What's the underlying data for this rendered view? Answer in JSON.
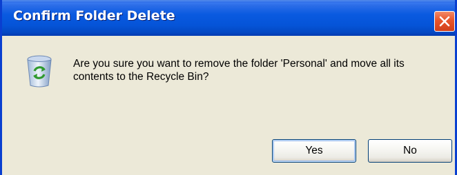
{
  "dialog": {
    "title": "Confirm Folder Delete",
    "message": "Are you sure you want to remove the folder 'Personal' and move all its contents to the Recycle Bin?",
    "icon": "recycle-bin-icon",
    "close_icon": "close-icon",
    "buttons": {
      "yes_label": "Yes",
      "no_label": "No"
    }
  },
  "colors": {
    "titlebar": "#0554d8",
    "window_border": "#0a3fd0",
    "close_button": "#e8542a",
    "body_background": "#ece9d8"
  }
}
